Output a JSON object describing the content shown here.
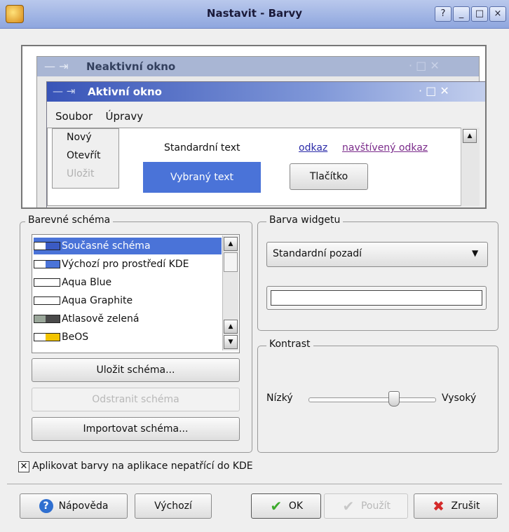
{
  "window": {
    "title": "Nastavit - Barvy",
    "controls": {
      "help": "?",
      "minimize": "_",
      "maximize": "□",
      "close": "×"
    }
  },
  "preview": {
    "inactive_title": "Neaktivní okno",
    "active_title": "Aktivní okno",
    "menu": [
      "Soubor",
      "Úpravy"
    ],
    "popup_items": [
      "Nový",
      "Otevřít",
      "Uložit"
    ],
    "standard_text": "Standardní text",
    "selected_text": "Vybraný text",
    "link": "odkaz",
    "visited_link": "navštívený odkaz",
    "button": "Tlačítko"
  },
  "scheme": {
    "group_title": "Barevné schéma",
    "items": [
      {
        "label": "Současné schéma",
        "swatch": [
          "#ffffff",
          "#3b5bc4"
        ],
        "selected": true
      },
      {
        "label": "Výchozí pro prostředí KDE",
        "swatch": [
          "#ffffff",
          "#4a73d8"
        ]
      },
      {
        "label": "Aqua Blue",
        "swatch": [
          "#ffffff",
          "#ffffff"
        ]
      },
      {
        "label": "Aqua Graphite",
        "swatch": [
          "#ffffff",
          "#ffffff"
        ]
      },
      {
        "label": "Atlasově zelená",
        "swatch": [
          "#9aa79a",
          "#4a4a4a"
        ]
      },
      {
        "label": "BeOS",
        "swatch": [
          "#ffffff",
          "#f2c400"
        ]
      }
    ],
    "save_button": "Uložit schéma...",
    "remove_button": "Odstranit schéma",
    "import_button": "Importovat schéma..."
  },
  "widget_color": {
    "group_title": "Barva widgetu",
    "selected_option": "Standardní pozadí",
    "color_value": "#ffffff"
  },
  "contrast": {
    "group_title": "Kontrast",
    "low_label": "Nízký",
    "high_label": "Vysoký",
    "value_fraction": 0.67
  },
  "apply_checkbox": {
    "label": "Aplikovat barvy na aplikace nepatřící do KDE",
    "checked": true
  },
  "buttons": {
    "help": "Nápověda",
    "defaults": "Výchozí",
    "ok": "OK",
    "apply": "Použít",
    "cancel": "Zrušit"
  },
  "colors": {
    "accent": "#4a73d8",
    "selection": "#3b5bc4",
    "background": "#efefef"
  }
}
